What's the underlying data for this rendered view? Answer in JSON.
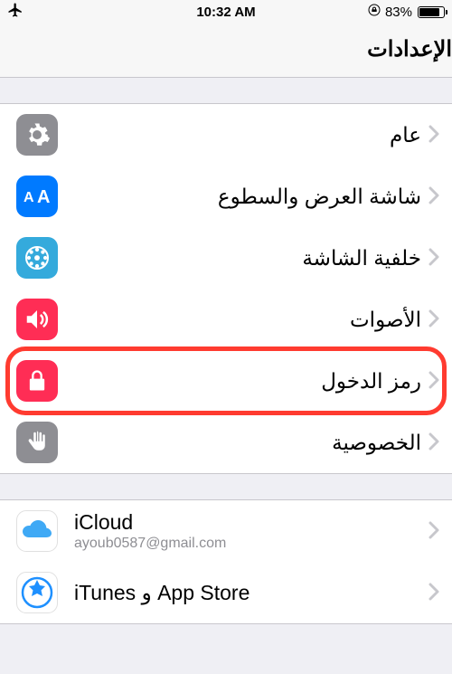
{
  "status": {
    "time": "10:32 AM",
    "battery_percent": "83%"
  },
  "header": {
    "title": "الإعدادات"
  },
  "group1": [
    {
      "label": "عام",
      "icon": "gear",
      "bg": "#8e8e93",
      "rtl": true
    },
    {
      "label": "شاشة العرض والسطوع",
      "icon": "display",
      "bg": "#007aff",
      "rtl": true
    },
    {
      "label": "خلفية الشاشة",
      "icon": "wallpaper",
      "bg": "#34aadc",
      "rtl": true
    },
    {
      "label": "الأصوات",
      "icon": "sound",
      "bg": "#ff2d55",
      "rtl": true
    },
    {
      "label": "رمز الدخول",
      "icon": "lock",
      "bg": "#ff2d55",
      "rtl": true,
      "highlight": true
    },
    {
      "label": "الخصوصية",
      "icon": "hand",
      "bg": "#8e8e93",
      "rtl": true
    }
  ],
  "group2": [
    {
      "label": "iCloud",
      "sub": "ayoub0587@gmail.com",
      "icon": "cloud",
      "bg": "#ffffff",
      "rtl": false
    },
    {
      "label": "iTunes و App Store",
      "icon": "appstore",
      "bg": "#ffffff",
      "rtl": false
    }
  ]
}
